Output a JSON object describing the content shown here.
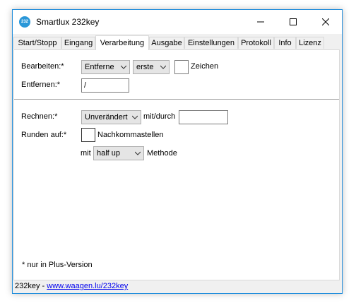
{
  "window": {
    "title": "Smartlux 232key",
    "icon_text": "232"
  },
  "tabs": [
    {
      "label": "Start/Stopp",
      "active": false
    },
    {
      "label": "Eingang",
      "active": false
    },
    {
      "label": "Verarbeitung",
      "active": true
    },
    {
      "label": "Ausgabe",
      "active": false
    },
    {
      "label": "Einstellungen",
      "active": false
    },
    {
      "label": "Protokoll",
      "active": false
    },
    {
      "label": "Info",
      "active": false
    },
    {
      "label": "Lizenz",
      "active": false
    }
  ],
  "processing": {
    "edit_label": "Bearbeiten:*",
    "edit_mode_value": "Entferne",
    "edit_position_value": "erste",
    "edit_count_value": "",
    "chars_label": "Zeichen",
    "remove_label": "Entfernen:*",
    "remove_value": "/",
    "calc_label": "Rechnen:*",
    "calc_value": "Unverändert",
    "with_by_label": "mit/durch",
    "with_by_value": "",
    "round_label": "Runden auf:*",
    "round_checked": false,
    "decimals_label": "Nachkommastellen",
    "with_label": "mit",
    "method_value": "half up",
    "method_label": "Methode",
    "plus_note": "* nur in Plus-Version"
  },
  "status": {
    "prefix": "232key - ",
    "link_text": "www.waagen.lu/232key"
  },
  "colors": {
    "window_border": "#1f8cdb",
    "icon_bg": "#2a97d8",
    "link": "#0000ee"
  }
}
